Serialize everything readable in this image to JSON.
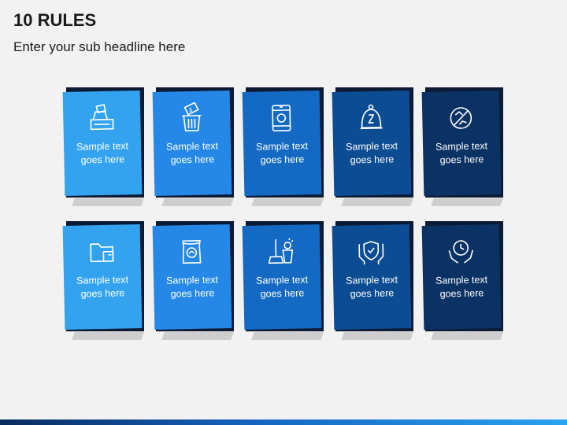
{
  "header": {
    "title": "10 RULES",
    "subtitle": "Enter your sub headline here"
  },
  "cards": [
    {
      "line1": "Sample text",
      "line2": "goes here",
      "icon": "cash-register-icon",
      "color": "#33a3f0"
    },
    {
      "line1": "Sample text",
      "line2": "goes here",
      "icon": "money-trash-icon",
      "color": "#2588e6"
    },
    {
      "line1": "Sample text",
      "line2": "goes here",
      "icon": "toxic-barrel-icon",
      "color": "#1469c2"
    },
    {
      "line1": "Sample text",
      "line2": "goes here",
      "icon": "sleeping-bell-icon",
      "color": "#0c4c93"
    },
    {
      "line1": "Sample text",
      "line2": "goes here",
      "icon": "no-bullying-icon",
      "color": "#0a3264"
    },
    {
      "line1": "Sample text",
      "line2": "goes here",
      "icon": "folder-icon",
      "color": "#33a3f0"
    },
    {
      "line1": "Sample text",
      "line2": "goes here",
      "icon": "seed-bag-icon",
      "color": "#2588e6"
    },
    {
      "line1": "Sample text",
      "line2": "goes here",
      "icon": "cleaning-tools-icon",
      "color": "#1469c2"
    },
    {
      "line1": "Sample text",
      "line2": "goes here",
      "icon": "protect-hands-icon",
      "color": "#0c4c93"
    },
    {
      "line1": "Sample text",
      "line2": "goes here",
      "icon": "time-hands-icon",
      "color": "#0a3264"
    }
  ]
}
